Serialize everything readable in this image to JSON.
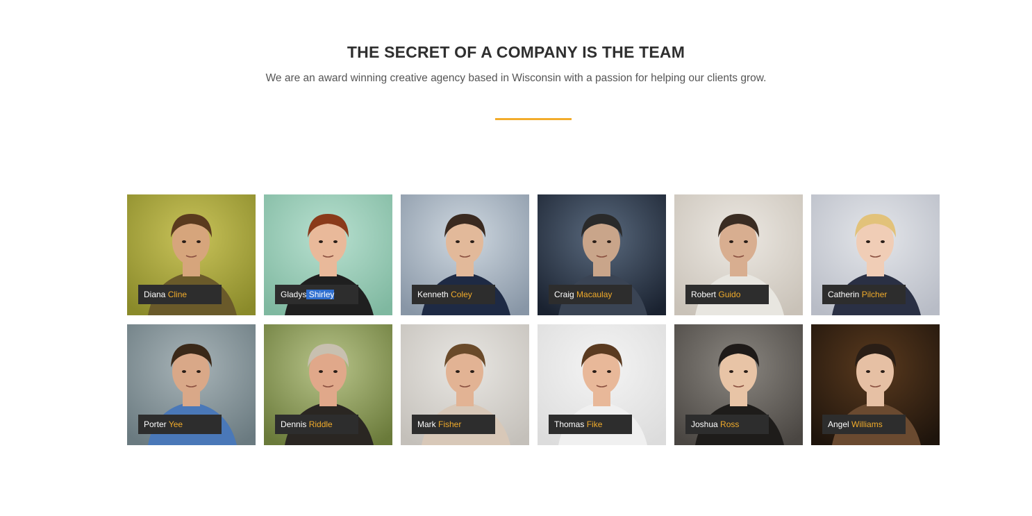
{
  "header": {
    "title": "THE SECRET OF A COMPANY IS THE TEAM",
    "subtitle": "We are an award winning creative agency based in Wisconsin with a passion for helping our clients grow."
  },
  "colors": {
    "accent": "#f2ac2b",
    "tag_background": "#2d2d2d",
    "selection": "#2f6fd0",
    "title": "#2f2f2f"
  },
  "team": [
    {
      "first": "Diana",
      "last": "Cline",
      "photo": "woman-long-hair-portrait",
      "bg": [
        "#c9c35a",
        "#8a8a2a"
      ],
      "skin": "#d6a57c",
      "hair": "#5a3a1e",
      "shirt": "#6a5a2a"
    },
    {
      "first": "Gladys",
      "last": "Shirley",
      "photo": "woman-with-camera-portrait",
      "bg": [
        "#b8e0d0",
        "#7fb8a0"
      ],
      "skin": "#e9b99a",
      "hair": "#8a3a1a",
      "shirt": "#1f1f1f",
      "selected": true
    },
    {
      "first": "Kenneth",
      "last": "Coley",
      "photo": "man-glasses-striped-shirt-portrait",
      "bg": [
        "#cfd8e0",
        "#8896a6"
      ],
      "skin": "#e2b99a",
      "hair": "#3a2a20",
      "shirt": "#1e2a44"
    },
    {
      "first": "Craig",
      "last": "Macaulay",
      "photo": "man-with-camera-portrait",
      "bg": [
        "#5a6a7e",
        "#1a2230"
      ],
      "skin": "#c9a58a",
      "hair": "#2a2a2a",
      "shirt": "#3a4454"
    },
    {
      "first": "Robert",
      "last": "Guido",
      "photo": "man-leather-jacket-portrait",
      "bg": [
        "#ece8e2",
        "#c9c2b8"
      ],
      "skin": "#d8ae90",
      "hair": "#3a2c22",
      "shirt": "#e8e6e0"
    },
    {
      "first": "Catherin",
      "last": "Pilcher",
      "photo": "woman-glasses-blonde-portrait",
      "bg": [
        "#e4e6ea",
        "#b8bcc6"
      ],
      "skin": "#f0cdb6",
      "hair": "#e2c27a",
      "shirt": "#2a3044"
    },
    {
      "first": "Porter",
      "last": "Yee",
      "photo": "man-blue-shirt-portrait",
      "bg": [
        "#a8b4b8",
        "#6a7a80"
      ],
      "skin": "#d9a888",
      "hair": "#3a2818",
      "shirt": "#4a78b8"
    },
    {
      "first": "Dennis",
      "last": "Riddle",
      "photo": "smiling-man-outdoor-portrait",
      "bg": [
        "#b8c48a",
        "#6a7a3a"
      ],
      "skin": "#e0a88a",
      "hair": "#c8c0b0",
      "shirt": "#2a2622"
    },
    {
      "first": "Mark",
      "last": "Fisher",
      "photo": "man-thinking-portrait",
      "bg": [
        "#e8e6e2",
        "#c4c0ba"
      ],
      "skin": "#e2b394",
      "hair": "#6a4a2a",
      "shirt": "#d8c8b8"
    },
    {
      "first": "Thomas",
      "last": "Fike",
      "photo": "young-man-portrait",
      "bg": [
        "#f4f4f4",
        "#dcdcdc"
      ],
      "skin": "#e8b899",
      "hair": "#5a3a20",
      "shirt": "#f0f0f0"
    },
    {
      "first": "Joshua",
      "last": "Ross",
      "photo": "man-dark-jacket-portrait",
      "bg": [
        "#8a8680",
        "#4a4642"
      ],
      "skin": "#e8c4a6",
      "hair": "#1e1a18",
      "shirt": "#1e1c1a"
    },
    {
      "first": "Angel",
      "last": "Williams",
      "photo": "woman-beanie-portrait",
      "bg": [
        "#5a3a1e",
        "#1e140c"
      ],
      "skin": "#e6c0a4",
      "hair": "#2a1e16",
      "shirt": "#6a4a30"
    }
  ]
}
